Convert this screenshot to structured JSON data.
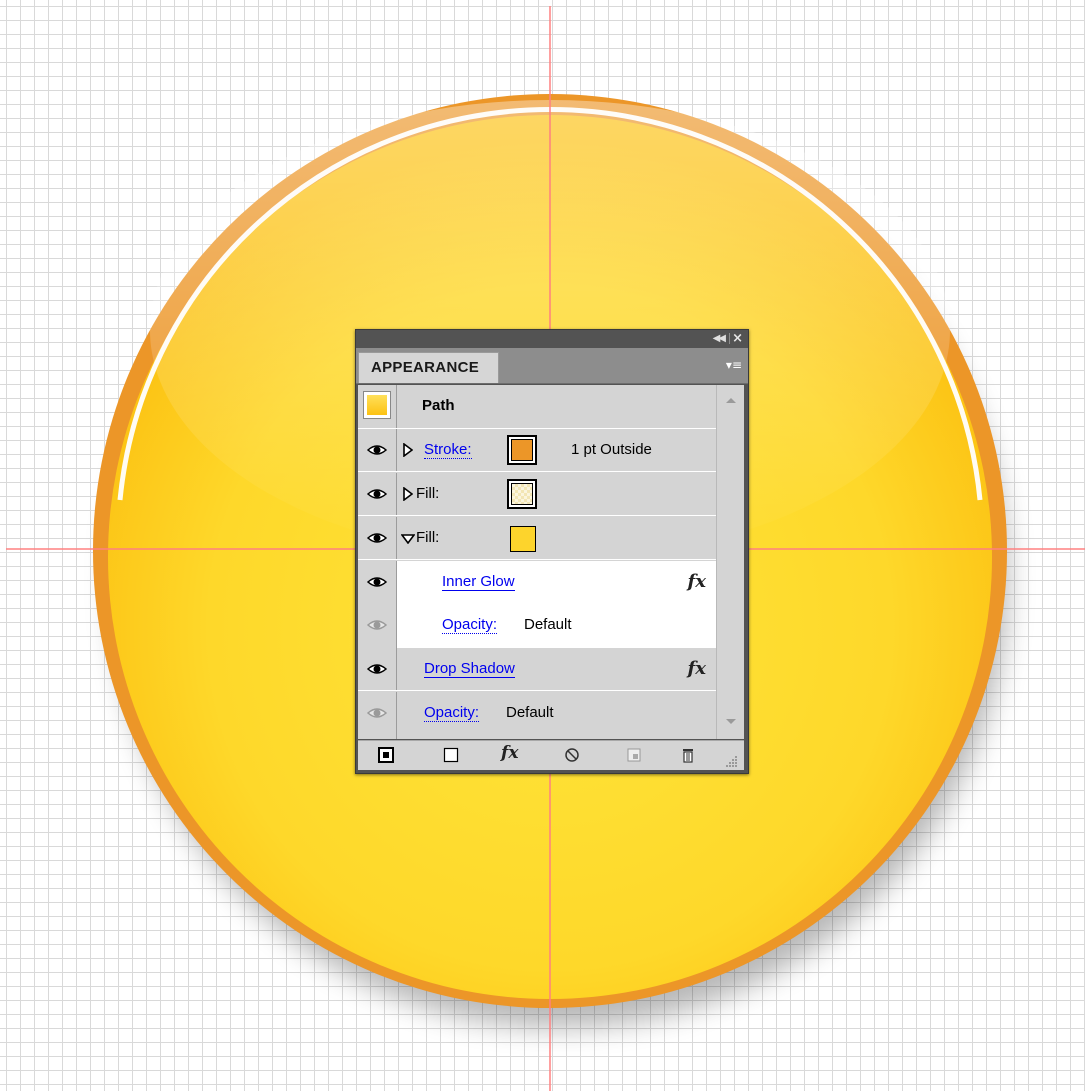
{
  "colors": {
    "stroke_orange": "#ec9628",
    "fill_yellow": "#fdd42c",
    "guide_red": "#ff8080",
    "grid": "#d9d9d9"
  },
  "panel": {
    "title_collapse_icon": "collapse-double-arrow-icon",
    "close_icon": "close-x-icon",
    "tab_label": "APPEARANCE",
    "menu_icon": "panel-menu-icon",
    "object_label": "Path",
    "rows": {
      "stroke": {
        "label": "Stroke:",
        "value": "1 pt  Outside",
        "swatch": "#ec9628"
      },
      "fill1": {
        "label": "Fill:"
      },
      "fill2": {
        "label": "Fill:",
        "swatch": "#fdd42c"
      },
      "inner_glow": {
        "label": "Inner Glow",
        "fx": "fx"
      },
      "fill_opacity": {
        "label": "Opacity:",
        "value": "Default"
      },
      "drop_shadow": {
        "label": "Drop Shadow",
        "fx": "fx"
      },
      "opacity": {
        "label": "Opacity:",
        "value": "Default"
      }
    },
    "bottom_fx": "fx"
  }
}
